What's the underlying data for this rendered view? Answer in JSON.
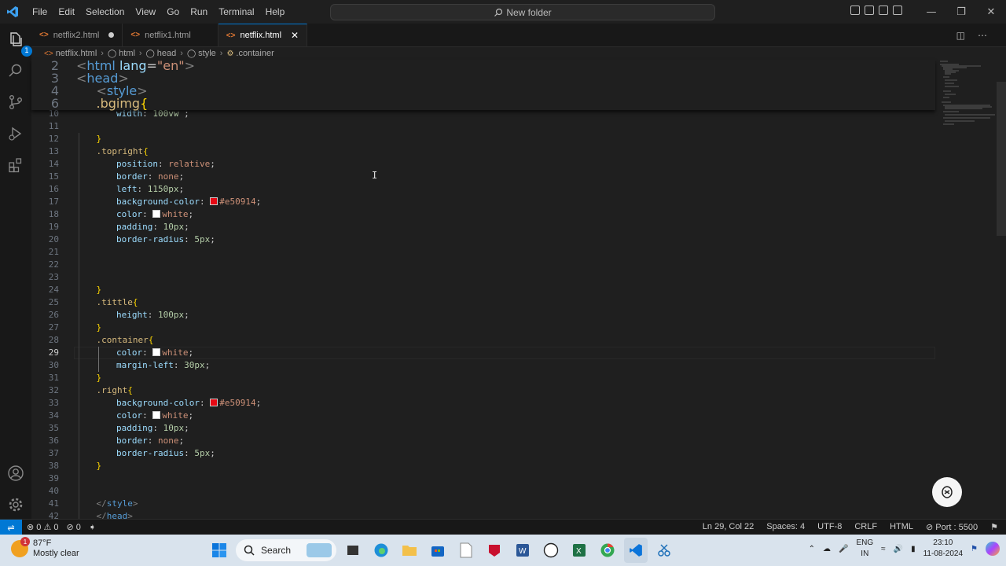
{
  "titlebar": {
    "menu": [
      "File",
      "Edit",
      "Selection",
      "View",
      "Go",
      "Run",
      "Terminal",
      "Help"
    ],
    "command_center": "New folder"
  },
  "tabs": [
    {
      "label": "netflix2.html",
      "modified": true
    },
    {
      "label": "netflix1.html",
      "modified": false
    },
    {
      "label": "netflix.html",
      "active": true
    }
  ],
  "breadcrumb": [
    "netflix.html",
    "html",
    "head",
    "style",
    ".container"
  ],
  "activity_bar": {
    "explorer_badge": "1"
  },
  "editor": {
    "sticky": [
      {
        "n": "2",
        "indent": 0,
        "tokens": [
          [
            "tg",
            "<"
          ],
          [
            "tn",
            "html"
          ],
          [
            "pn",
            " "
          ],
          [
            "at",
            "lang"
          ],
          [
            "pn",
            "="
          ],
          [
            "sv",
            "\"en\""
          ],
          [
            "tg",
            ">"
          ]
        ]
      },
      {
        "n": "3",
        "indent": 0,
        "tokens": [
          [
            "tg",
            "<"
          ],
          [
            "tn",
            "head"
          ],
          [
            "tg",
            ">"
          ]
        ]
      },
      {
        "n": "4",
        "indent": 1,
        "tokens": [
          [
            "tg",
            "<"
          ],
          [
            "tn",
            "style"
          ],
          [
            "tg",
            ">"
          ]
        ]
      },
      {
        "n": "6",
        "indent": 1,
        "tokens": [
          [
            "sel",
            ".bgimg"
          ],
          [
            "br",
            "{"
          ]
        ]
      }
    ],
    "lines": [
      {
        "n": "10",
        "indent": 2,
        "tokens": [
          [
            "pr",
            "width"
          ],
          [
            "pn",
            ": "
          ],
          [
            "num",
            "100vw"
          ],
          [
            "pn",
            " ;"
          ]
        ]
      },
      {
        "n": "11",
        "indent": 0,
        "tokens": []
      },
      {
        "n": "12",
        "indent": 1,
        "tokens": [
          [
            "br",
            "}"
          ]
        ]
      },
      {
        "n": "13",
        "indent": 1,
        "tokens": [
          [
            "sel",
            ".topright"
          ],
          [
            "br",
            "{"
          ]
        ]
      },
      {
        "n": "14",
        "indent": 2,
        "tokens": [
          [
            "pr",
            "position"
          ],
          [
            "pn",
            ": "
          ],
          [
            "val",
            "relative"
          ],
          [
            "pn",
            ";"
          ]
        ]
      },
      {
        "n": "15",
        "indent": 2,
        "tokens": [
          [
            "pr",
            "border"
          ],
          [
            "pn",
            ": "
          ],
          [
            "val",
            "none"
          ],
          [
            "pn",
            ";"
          ]
        ]
      },
      {
        "n": "16",
        "indent": 2,
        "tokens": [
          [
            "pr",
            "left"
          ],
          [
            "pn",
            ": "
          ],
          [
            "num",
            "1150px"
          ],
          [
            "pn",
            ";"
          ]
        ]
      },
      {
        "n": "17",
        "indent": 2,
        "tokens": [
          [
            "pr",
            "background-color"
          ],
          [
            "pn",
            ": "
          ],
          [
            "sw",
            "#e50914"
          ],
          [
            "val",
            "#e50914"
          ],
          [
            "pn",
            ";"
          ]
        ]
      },
      {
        "n": "18",
        "indent": 2,
        "tokens": [
          [
            "pr",
            "color"
          ],
          [
            "pn",
            ": "
          ],
          [
            "sw",
            "#ffffff"
          ],
          [
            "val",
            "white"
          ],
          [
            "pn",
            ";"
          ]
        ]
      },
      {
        "n": "19",
        "indent": 2,
        "tokens": [
          [
            "pr",
            "padding"
          ],
          [
            "pn",
            ": "
          ],
          [
            "num",
            "10px"
          ],
          [
            "pn",
            ";"
          ]
        ]
      },
      {
        "n": "20",
        "indent": 2,
        "tokens": [
          [
            "pr",
            "border-radius"
          ],
          [
            "pn",
            ": "
          ],
          [
            "num",
            "5px"
          ],
          [
            "pn",
            ";"
          ]
        ]
      },
      {
        "n": "21",
        "indent": 0,
        "tokens": []
      },
      {
        "n": "22",
        "indent": 0,
        "tokens": []
      },
      {
        "n": "23",
        "indent": 0,
        "tokens": []
      },
      {
        "n": "24",
        "indent": 1,
        "tokens": [
          [
            "br",
            "}"
          ]
        ]
      },
      {
        "n": "25",
        "indent": 1,
        "tokens": [
          [
            "sel",
            ".tittle"
          ],
          [
            "br",
            "{"
          ]
        ]
      },
      {
        "n": "26",
        "indent": 2,
        "tokens": [
          [
            "pr",
            "height"
          ],
          [
            "pn",
            ": "
          ],
          [
            "num",
            "100px"
          ],
          [
            "pn",
            ";"
          ]
        ]
      },
      {
        "n": "27",
        "indent": 1,
        "tokens": [
          [
            "br",
            "}"
          ]
        ]
      },
      {
        "n": "28",
        "indent": 1,
        "tokens": [
          [
            "sel",
            ".container"
          ],
          [
            "br",
            "{"
          ]
        ]
      },
      {
        "n": "29",
        "indent": 2,
        "current": true,
        "tokens": [
          [
            "pr",
            "color"
          ],
          [
            "pn",
            ": "
          ],
          [
            "sw",
            "#ffffff"
          ],
          [
            "val",
            "white"
          ],
          [
            "pn",
            ";"
          ]
        ]
      },
      {
        "n": "30",
        "indent": 2,
        "tokens": [
          [
            "pr",
            "margin-left"
          ],
          [
            "pn",
            ": "
          ],
          [
            "num",
            "30px"
          ],
          [
            "pn",
            ";"
          ]
        ]
      },
      {
        "n": "31",
        "indent": 1,
        "tokens": [
          [
            "br",
            "}"
          ]
        ]
      },
      {
        "n": "32",
        "indent": 1,
        "tokens": [
          [
            "sel",
            ".right"
          ],
          [
            "br",
            "{"
          ]
        ]
      },
      {
        "n": "33",
        "indent": 2,
        "tokens": [
          [
            "pr",
            "background-color"
          ],
          [
            "pn",
            ": "
          ],
          [
            "sw",
            "#e50914"
          ],
          [
            "val",
            "#e50914"
          ],
          [
            "pn",
            ";"
          ]
        ]
      },
      {
        "n": "34",
        "indent": 2,
        "tokens": [
          [
            "pr",
            "color"
          ],
          [
            "pn",
            ": "
          ],
          [
            "sw",
            "#ffffff"
          ],
          [
            "val",
            "white"
          ],
          [
            "pn",
            ";"
          ]
        ]
      },
      {
        "n": "35",
        "indent": 2,
        "tokens": [
          [
            "pr",
            "padding"
          ],
          [
            "pn",
            ": "
          ],
          [
            "num",
            "10px"
          ],
          [
            "pn",
            ";"
          ]
        ]
      },
      {
        "n": "36",
        "indent": 2,
        "tokens": [
          [
            "pr",
            "border"
          ],
          [
            "pn",
            ": "
          ],
          [
            "val",
            "none"
          ],
          [
            "pn",
            ";"
          ]
        ]
      },
      {
        "n": "37",
        "indent": 2,
        "tokens": [
          [
            "pr",
            "border-radius"
          ],
          [
            "pn",
            ": "
          ],
          [
            "num",
            "5px"
          ],
          [
            "pn",
            ";"
          ]
        ]
      },
      {
        "n": "38",
        "indent": 1,
        "tokens": [
          [
            "br",
            "}"
          ]
        ]
      },
      {
        "n": "39",
        "indent": 0,
        "tokens": []
      },
      {
        "n": "40",
        "indent": 0,
        "tokens": []
      },
      {
        "n": "41",
        "indent": 1,
        "tokens": [
          [
            "tg",
            "</"
          ],
          [
            "tn",
            "style"
          ],
          [
            "tg",
            ">"
          ]
        ]
      },
      {
        "n": "42",
        "indent": 1,
        "tokens": [
          [
            "tg",
            "</"
          ],
          [
            "tn",
            "head"
          ],
          [
            "tg",
            ">"
          ]
        ]
      }
    ]
  },
  "statusbar": {
    "errors": "0",
    "warnings": "0",
    "ports_count": "0",
    "position": "Ln 29, Col 22",
    "spaces": "Spaces: 4",
    "encoding": "UTF-8",
    "eol": "CRLF",
    "language": "HTML",
    "port": "Port : 5500"
  },
  "taskbar": {
    "temperature": "87°F",
    "weather": "Mostly clear",
    "weather_badge": "1",
    "search": "Search",
    "lang": "ENG",
    "region": "IN",
    "time": "23:10",
    "date": "11-08-2024"
  },
  "colors": {
    "accent": "#0078d4",
    "swatch_red": "#e50914"
  }
}
